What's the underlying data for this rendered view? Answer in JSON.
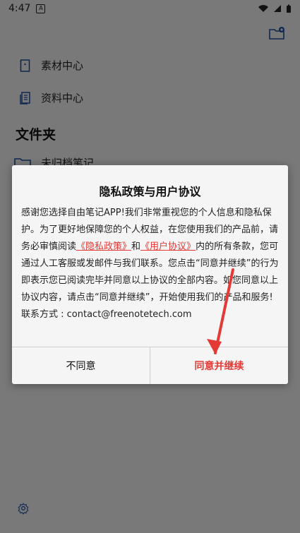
{
  "status": {
    "time": "4:47",
    "notif": "A"
  },
  "nav": [
    {
      "label": "素材中心",
      "icon": "book-icon"
    },
    {
      "label": "资料中心",
      "icon": "document-icon"
    }
  ],
  "section_title": "文件夹",
  "folder_row_label": "未归档笔记",
  "dialog": {
    "title": "隐私政策与用户协议",
    "p1": "感谢您选择自由笔记APP!我们非常重视您的个人信息和隐私保护。为了更好地保障您的个人权益，在您使用我们的产品前，请务必审慎阅读",
    "link1": "《隐私政策》",
    "and": "和",
    "link2": "《用户协议》",
    "p2": "内的所有条款，您可通过人工客服或发邮件与我们联系。您点击“同意并继续”的行为即表示您已阅读完毕并同意以上协议的全部内容。如您同意以上协议内容，请点击“同意并继续”，开始使用我们的产品和服务!",
    "contact": "联系方式 : contact@freenotetech.com",
    "reject_label": "不同意",
    "accept_label": "同意并继续"
  },
  "colors": {
    "accent": "#e53935",
    "arrow": "#e53935"
  }
}
